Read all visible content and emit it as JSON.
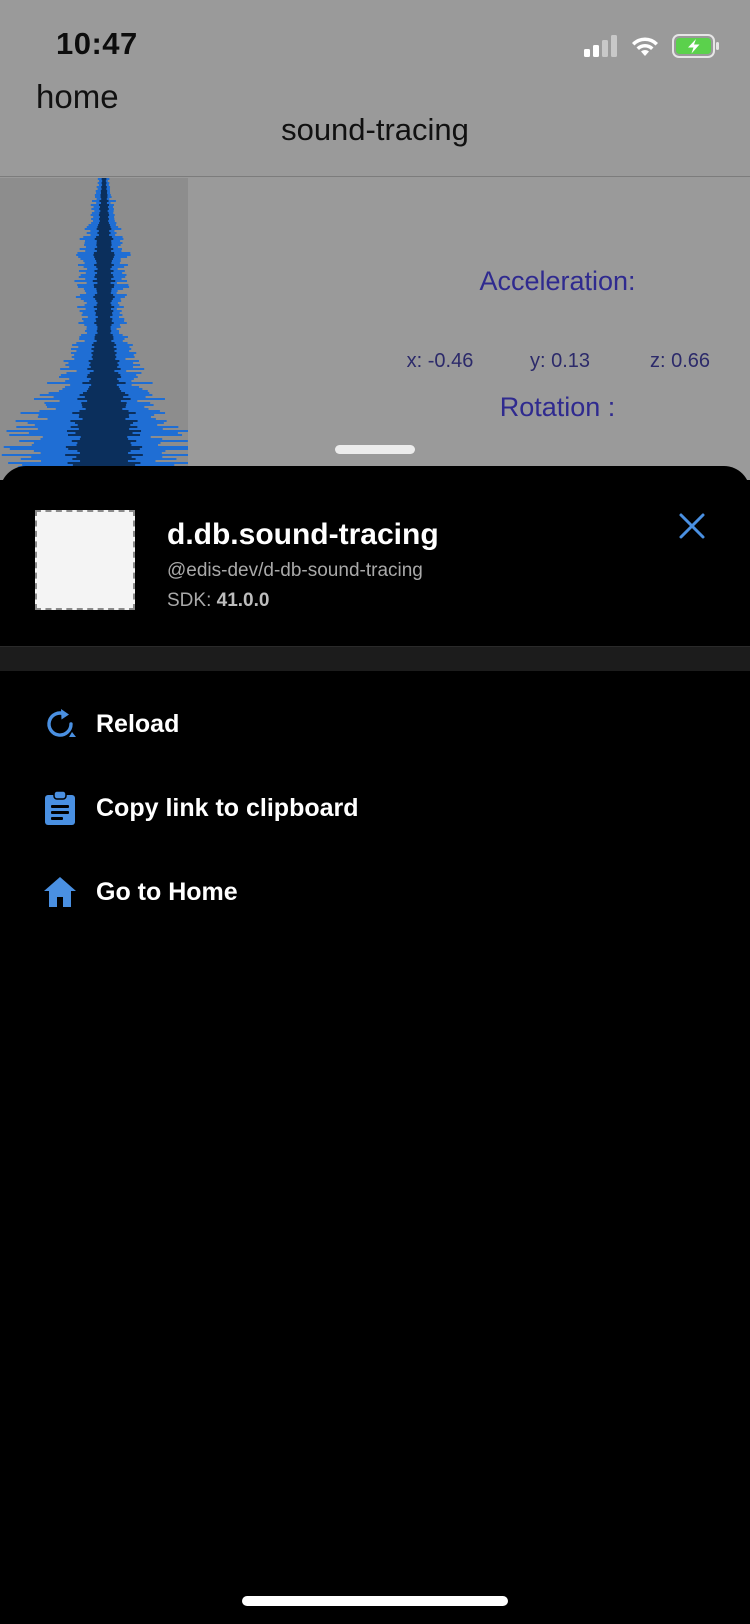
{
  "status_bar": {
    "time": "10:47",
    "icons": [
      "cellular-signal-icon",
      "wifi-icon",
      "battery-charging-icon"
    ]
  },
  "background_app": {
    "nav_back_label": "home",
    "title": "sound-tracing",
    "acceleration_label": "Acceleration:",
    "acceleration": {
      "x": "x: -0.46",
      "y": "y: 0.13",
      "z": "z: 0.66"
    },
    "rotation_label": "Rotation :",
    "waveform_color": "#1f6ed4"
  },
  "sheet": {
    "app_name": "d.db.sound-tracing",
    "app_slug": "@edis-dev/d-db-sound-tracing",
    "sdk_prefix": "SDK: ",
    "sdk_version": "41.0.0",
    "close_icon": "close-icon",
    "accent_color": "#4a90e2",
    "menu": [
      {
        "label": "Reload",
        "icon": "reload-icon"
      },
      {
        "label": "Copy link to clipboard",
        "icon": "clipboard-icon"
      },
      {
        "label": "Go to Home",
        "icon": "home-icon"
      }
    ]
  }
}
